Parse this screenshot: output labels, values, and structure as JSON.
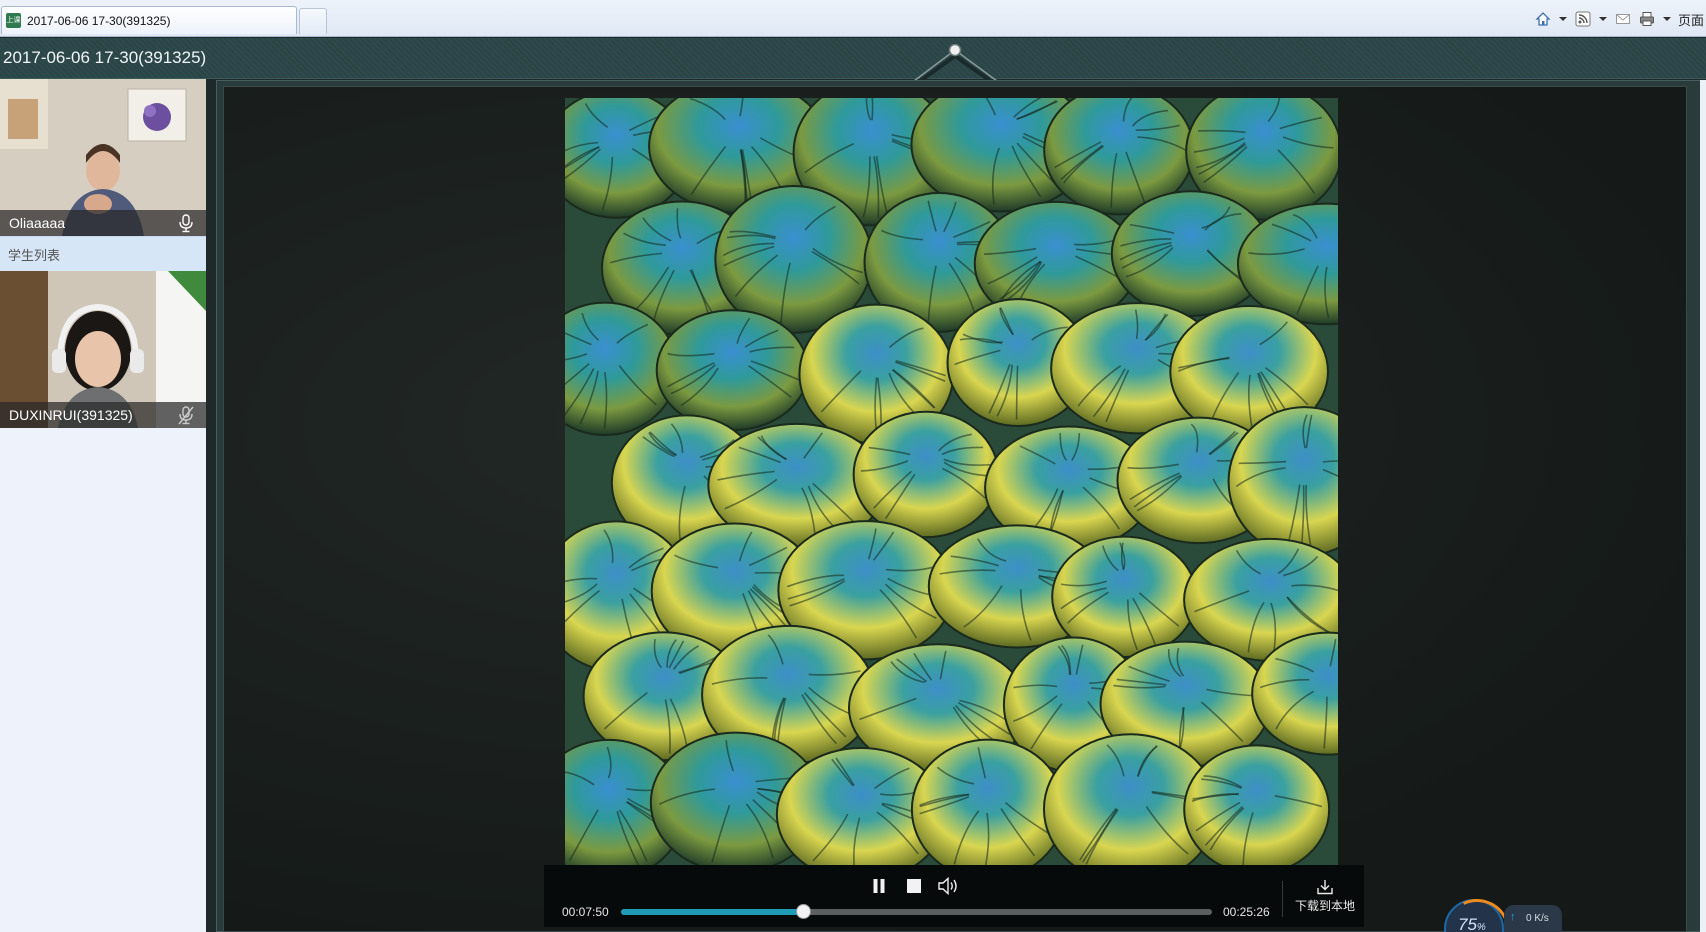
{
  "browser": {
    "tab_title": "2017-06-06 17-30(391325)",
    "favicon_text": "上课",
    "toolbar_text": "页面",
    "icons": [
      "home-icon",
      "rss-feed-icon",
      "read-mail-icon",
      "print-icon"
    ]
  },
  "app": {
    "title": "2017-06-06 17-30(391325)"
  },
  "sidebar": {
    "teacher": {
      "name": "Oliaaaaa",
      "mic": "mic-on"
    },
    "student_list_label": "学生列表",
    "students": [
      {
        "name": "DUXINRUI(391325)",
        "mic": "mic-muted"
      }
    ]
  },
  "player": {
    "current_time": "00:07:50",
    "total_time": "00:25:26",
    "progress": 0.308,
    "download_label": "下载到本地",
    "state": "playing",
    "accent": "#1f9bb6"
  },
  "network": {
    "percent": "75",
    "percent_unit": "%",
    "speed": "0 K/s"
  }
}
